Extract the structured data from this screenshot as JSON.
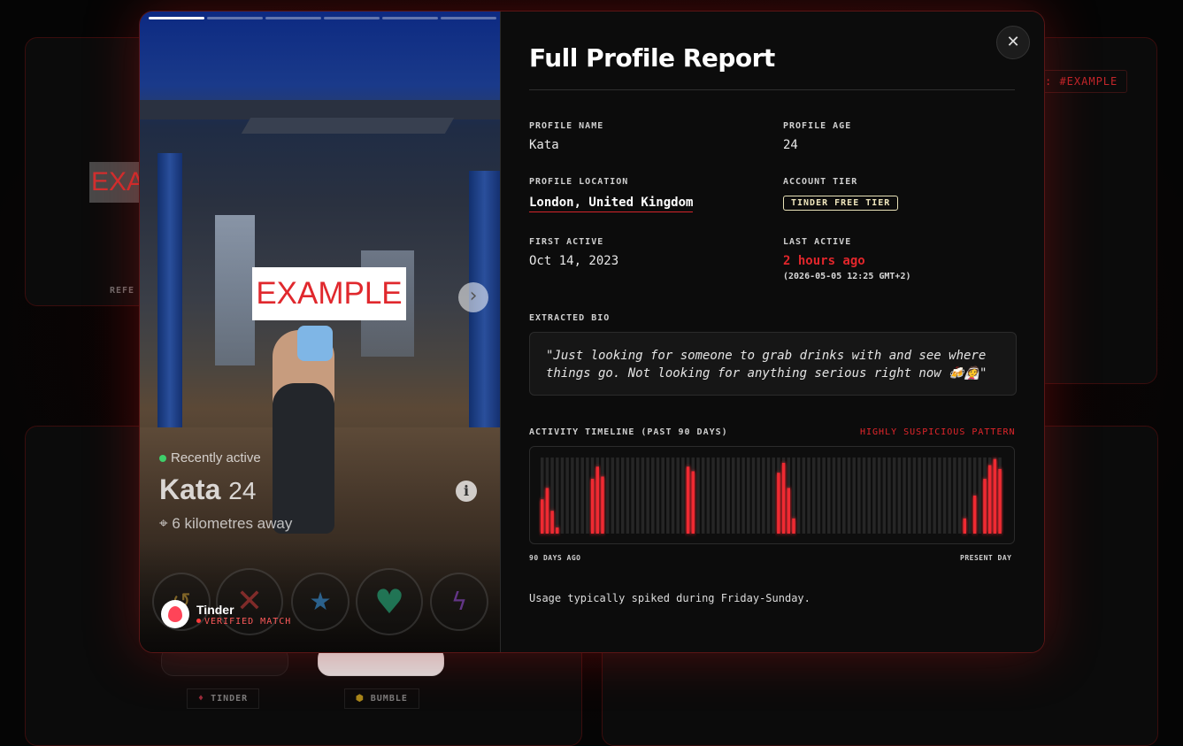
{
  "background": {
    "partial_tag": ": #EXAMPLE",
    "faded_label": "REFE",
    "thumb_label": "EXAM",
    "tinder_label": "TINDER",
    "bumble_label": "BUMBLE"
  },
  "photo_card": {
    "example_label": "EXAMPLE",
    "status": "Recently active",
    "name": "Kata",
    "age": "24",
    "distance": "6 kilometres away",
    "platform": "Tinder",
    "verified": "VERIFIED MATCH",
    "progress_segments": 6,
    "active_segment": 0,
    "icons": {
      "next": "chevron-right-icon",
      "info": "info-icon",
      "location": "location-pin-icon",
      "rewind": "rewind-icon",
      "nope": "x-icon",
      "superlike": "star-icon",
      "like": "heart-icon",
      "boost": "lightning-icon"
    }
  },
  "report": {
    "title": "Full Profile Report",
    "close_icon": "close-icon",
    "profile_name_label": "PROFILE NAME",
    "profile_name": "Kata",
    "profile_age_label": "PROFILE AGE",
    "profile_age": "24",
    "location_label": "PROFILE LOCATION",
    "location": "London, United Kingdom",
    "tier_label": "ACCOUNT TIER",
    "tier": "TINDER FREE TIER",
    "first_active_label": "FIRST ACTIVE",
    "first_active": "Oct 14, 2023",
    "last_active_label": "LAST ACTIVE",
    "last_active": "2 hours ago",
    "last_active_exact": "(2026-05-05 12:25 GMT+2)",
    "bio_label": "EXTRACTED BIO",
    "bio": "\"Just looking for someone to grab drinks with and see where things go. Not looking for anything serious right now 🍻👰\"",
    "timeline_label": "ACTIVITY TIMELINE (PAST 90 DAYS)",
    "timeline_flag": "HIGHLY SUSPICIOUS PATTERN",
    "timeline_start": "90 DAYS AGO",
    "timeline_end": "PRESENT DAY",
    "insight": "Usage typically spiked during Friday-Sunday."
  },
  "colors": {
    "accent_red": "#e2262b",
    "bar_active": "#ef2a33",
    "bar_idle": "#262626"
  },
  "chart_data": {
    "type": "bar",
    "xlabel": "",
    "ylabel": "",
    "x_range_labels": [
      "90 DAYS AGO",
      "PRESENT DAY"
    ],
    "values": [
      0.45,
      0.6,
      0.3,
      0.08,
      0,
      0,
      0,
      0,
      0,
      0,
      0.72,
      0.88,
      0.75,
      0,
      0,
      0,
      0,
      0,
      0,
      0,
      0,
      0,
      0,
      0,
      0,
      0,
      0,
      0,
      0,
      0.88,
      0.82,
      0,
      0,
      0,
      0,
      0,
      0,
      0,
      0,
      0,
      0,
      0,
      0,
      0,
      0,
      0,
      0,
      0.8,
      0.93,
      0.6,
      0.2,
      0,
      0,
      0,
      0,
      0,
      0,
      0,
      0,
      0,
      0,
      0,
      0,
      0,
      0,
      0,
      0,
      0,
      0,
      0,
      0,
      0,
      0,
      0,
      0,
      0,
      0,
      0,
      0,
      0,
      0,
      0,
      0,
      0,
      0.2,
      0,
      0.5,
      0,
      0.72,
      0.9,
      0.98,
      0.85
    ]
  }
}
